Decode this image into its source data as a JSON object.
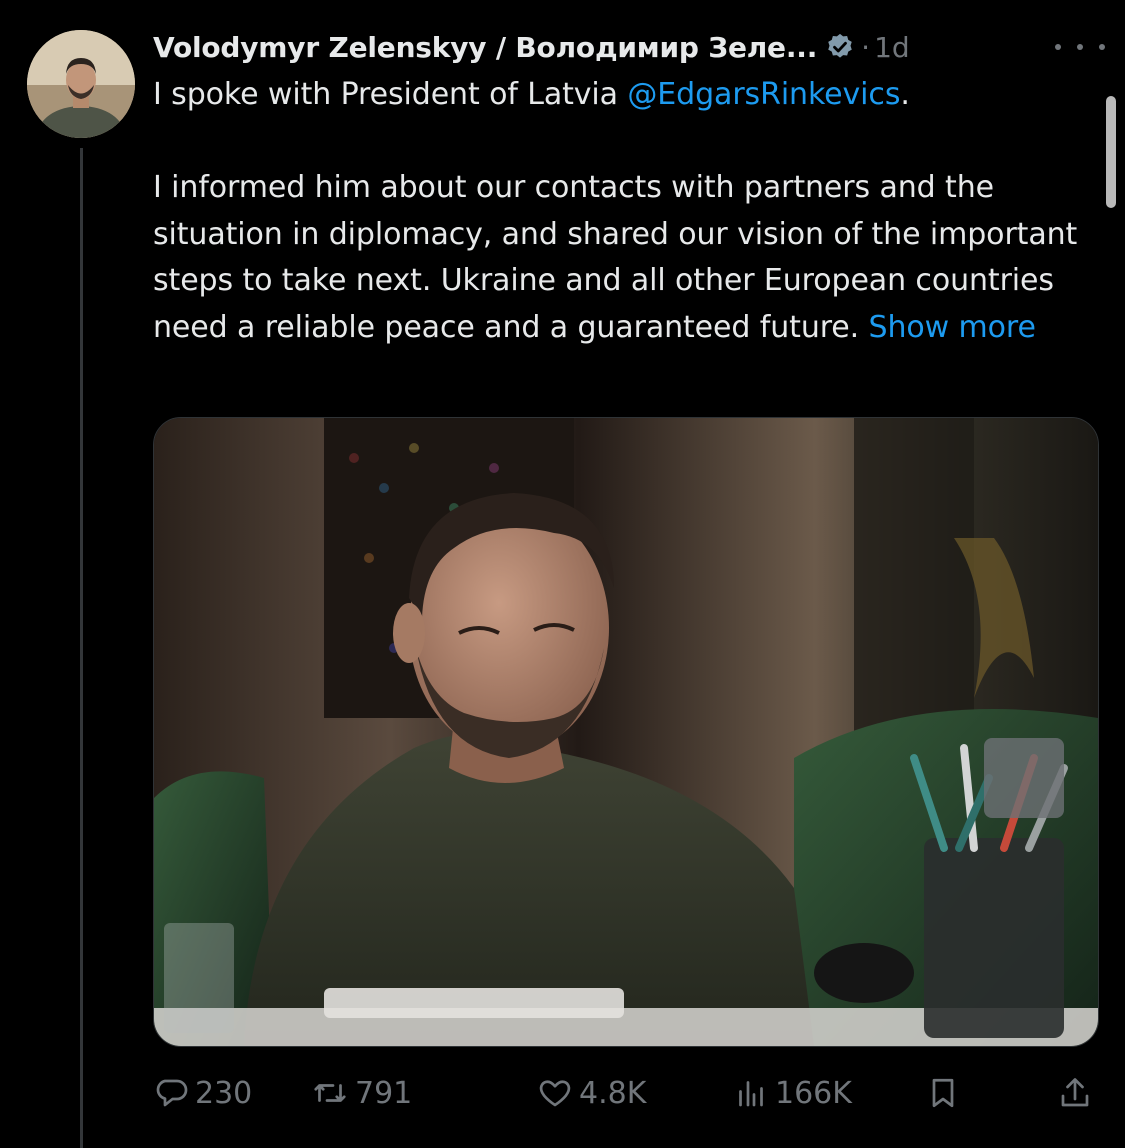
{
  "tweet": {
    "author_name": "Volodymyr Zelenskyy / Володимир Зеле...",
    "time_separator": "·",
    "timestamp": "1d",
    "text_line1_prefix": "I spoke with President of Latvia ",
    "mention": "@EdgarsRinkevics",
    "text_line1_suffix": ".",
    "paragraph2": "I informed him about our contacts with partners and the situation in diplomacy, and shared our vision of the important steps to take next. Ukraine and all other European countries need a reliable peace and a guaranteed future. ",
    "show_more": "Show more"
  },
  "actions": {
    "replies": "230",
    "reposts": "791",
    "likes": "4.8K",
    "views": "166K"
  },
  "icons": {
    "verified": "verified-badge-icon",
    "more": "more-options-icon",
    "reply": "reply-icon",
    "repost": "repost-icon",
    "like": "heart-icon",
    "views": "views-icon",
    "bookmark": "bookmark-icon",
    "share": "share-icon"
  },
  "colors": {
    "background": "#000000",
    "text": "#e7e9ea",
    "secondary": "#71767b",
    "link": "#1d9bf0"
  }
}
